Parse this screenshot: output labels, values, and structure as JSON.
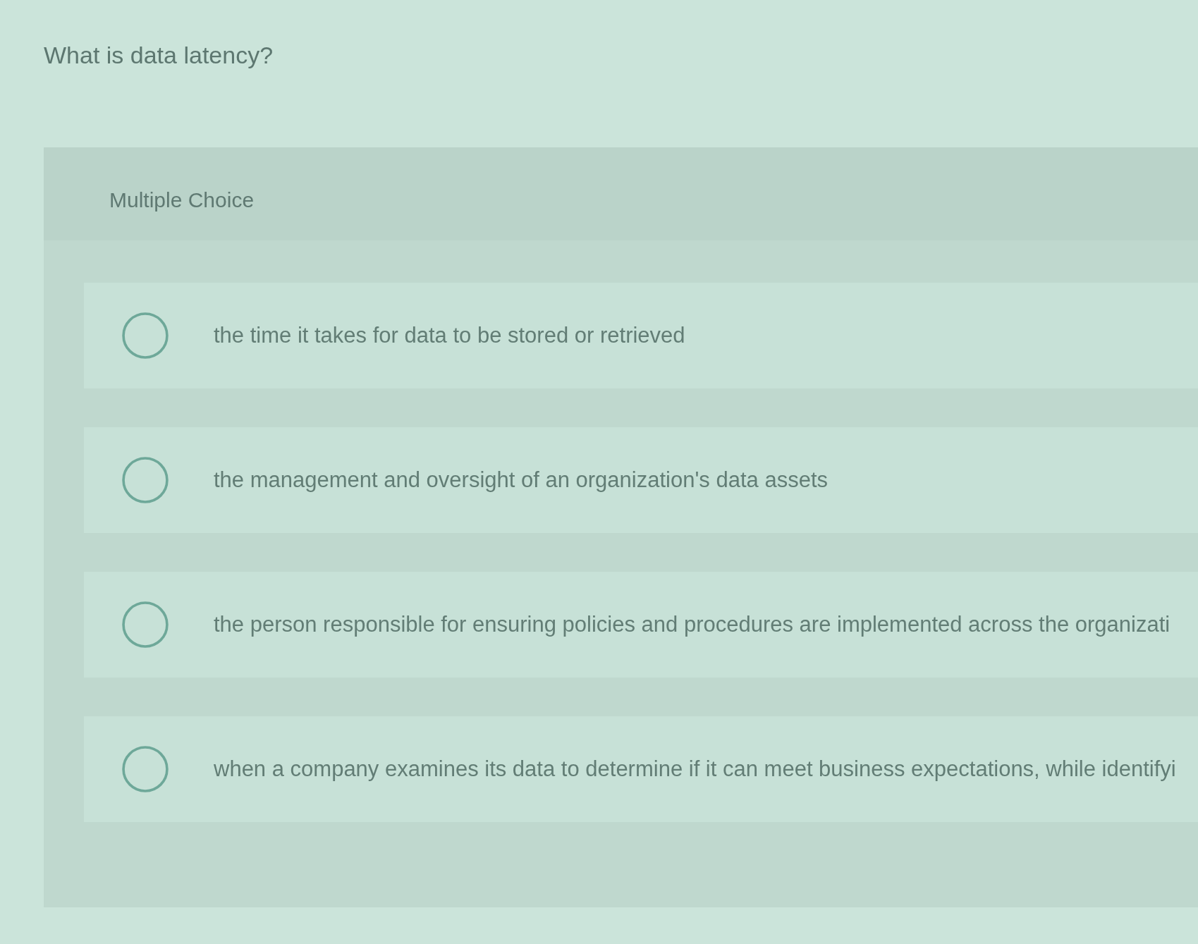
{
  "question": {
    "title": "What is data latency?"
  },
  "panel": {
    "type_label": "Multiple Choice"
  },
  "options": [
    {
      "text": "the time it takes for data to be stored or retrieved",
      "selected": false
    },
    {
      "text": "the management and oversight of an organization's data assets",
      "selected": false
    },
    {
      "text": "the person responsible for ensuring policies and procedures are implemented across the organizati",
      "selected": false
    },
    {
      "text": "when a company examines its data to determine if it can meet business expectations, while identifyi",
      "selected": false
    }
  ]
}
